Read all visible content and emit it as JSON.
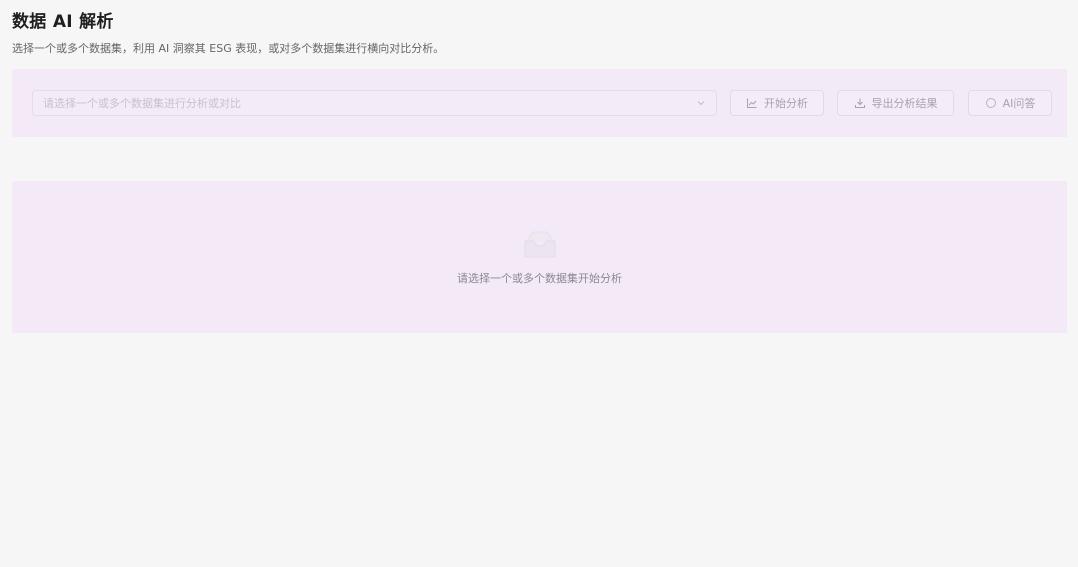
{
  "page": {
    "title": "数据 AI 解析",
    "subtitle": "选择一个或多个数据集，利用 AI 洞察其 ESG 表现，或对多个数据集进行横向对比分析。"
  },
  "toolbar": {
    "select_placeholder": "请选择一个或多个数据集进行分析或对比",
    "analyze_label": "开始分析",
    "export_label": "导出分析结果",
    "ai_label": "AI问答"
  },
  "result": {
    "empty_text": "请选择一个或多个数据集开始分析"
  },
  "icons": {
    "select_arrow": "chevron-down-icon",
    "analyze": "line-chart-icon",
    "export": "download-icon",
    "ai": "loading-icon",
    "empty": "empty-inbox-icon"
  },
  "colors": {
    "card_background": "#f4eaf7",
    "page_background": "#f6f6f6"
  }
}
